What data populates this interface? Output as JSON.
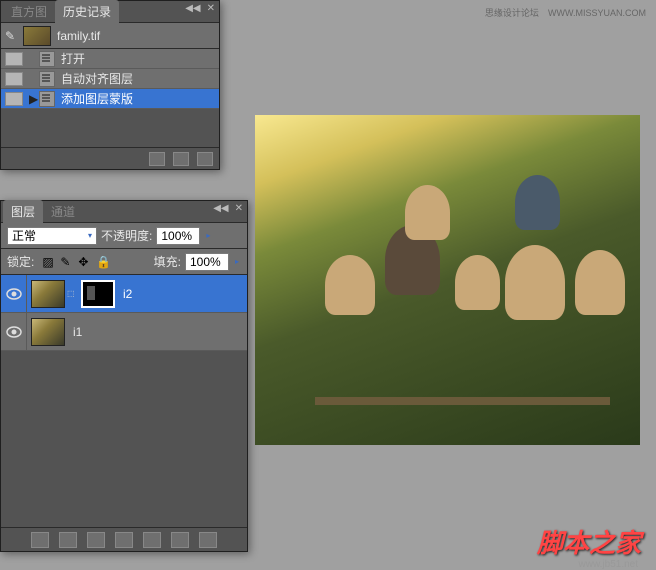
{
  "watermark": {
    "forum": "思缘设计论坛",
    "forum_url": "WWW.MISSYUAN.COM",
    "brand": "脚本之家",
    "url": "www.jb51.net"
  },
  "history_panel": {
    "tabs": {
      "histogram": "直方图",
      "history": "历史记录"
    },
    "filename": "family.tif",
    "items": [
      {
        "label": "打开"
      },
      {
        "label": "自动对齐图层"
      },
      {
        "label": "添加图层蒙版"
      }
    ]
  },
  "layers_panel": {
    "tabs": {
      "layers": "图层",
      "channels": "通道"
    },
    "blend_mode": "正常",
    "opacity_label": "不透明度:",
    "opacity_value": "100%",
    "lock_label": "锁定:",
    "fill_label": "填充:",
    "fill_value": "100%",
    "layers": [
      {
        "name": "i2",
        "has_mask": true
      },
      {
        "name": "i1",
        "has_mask": false
      }
    ]
  }
}
